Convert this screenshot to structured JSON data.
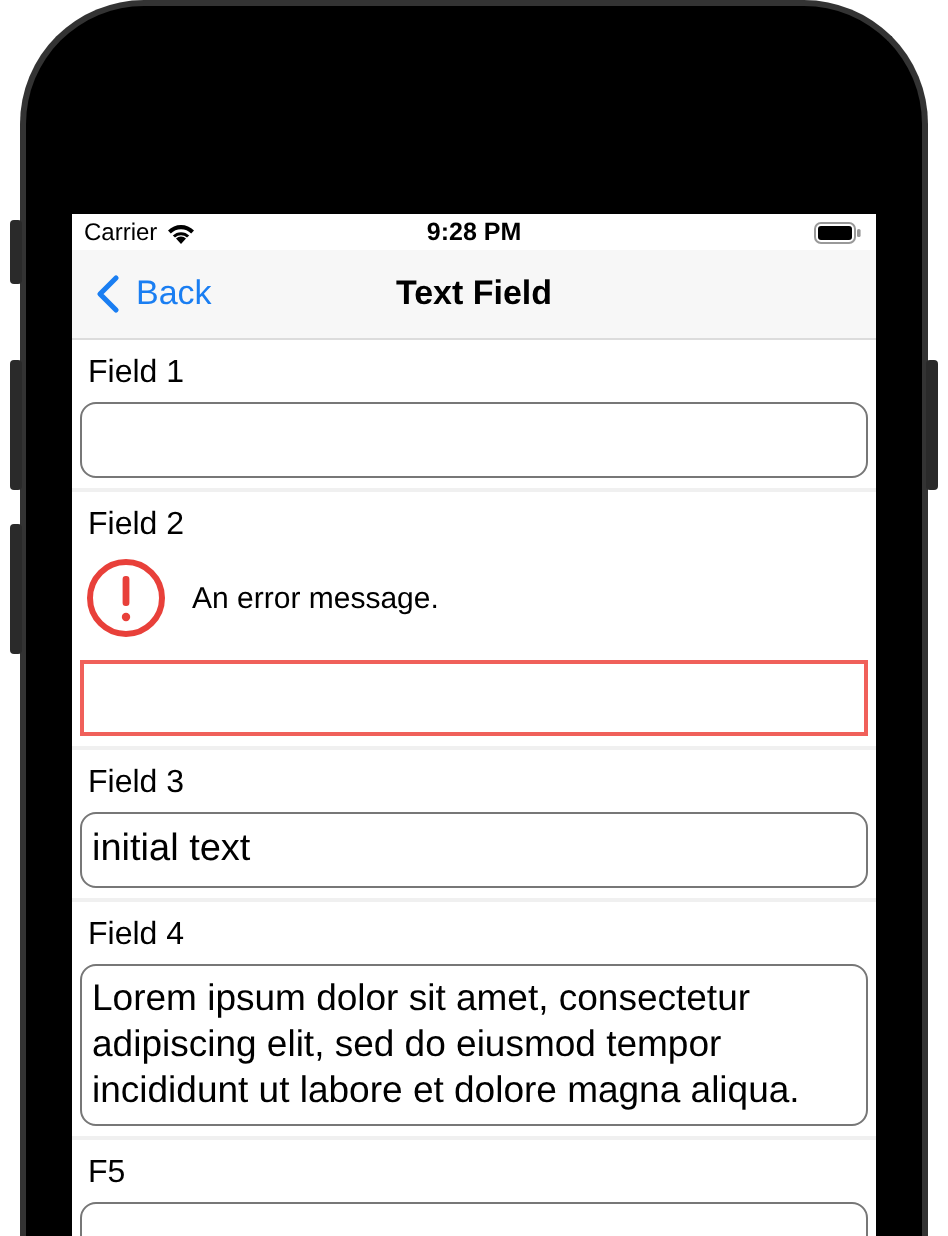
{
  "status_bar": {
    "carrier": "Carrier",
    "time": "9:28 PM"
  },
  "nav_bar": {
    "back": "Back",
    "title": "Text Field"
  },
  "fields": [
    {
      "label": "Field 1",
      "kind": "single",
      "error": false
    },
    {
      "label": "Field 2",
      "kind": "single",
      "error": true,
      "error_message": "An error message."
    },
    {
      "label": "Field 3",
      "kind": "single",
      "value": "initial text",
      "error": false
    },
    {
      "label": "Field 4",
      "kind": "multi",
      "value": "Lorem ipsum dolor sit amet, consectetur adipiscing elit, sed do eiusmod tempor incididunt ut labore et dolore magna aliqua.",
      "error": false
    },
    {
      "label": "F5",
      "kind": "single",
      "error": false
    }
  ]
}
